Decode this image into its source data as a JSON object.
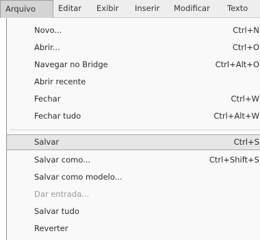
{
  "menubar": {
    "items": [
      {
        "label": "Arquivo"
      },
      {
        "label": "Editar"
      },
      {
        "label": "Exibir"
      },
      {
        "label": "Inserir"
      },
      {
        "label": "Modificar"
      },
      {
        "label": "Texto"
      }
    ],
    "active_index": 0
  },
  "menu": {
    "items": [
      {
        "label": "Novo...",
        "shortcut": "Ctrl+N"
      },
      {
        "label": "Abrir...",
        "shortcut": "Ctrl+O"
      },
      {
        "label": "Navegar no Bridge",
        "shortcut": "Ctrl+Alt+O"
      },
      {
        "label": "Abrir recente",
        "shortcut": ""
      },
      {
        "label": "Fechar",
        "shortcut": "Ctrl+W"
      },
      {
        "label": "Fechar tudo",
        "shortcut": "Ctrl+Alt+W"
      },
      {
        "label": "Salvar",
        "shortcut": "Ctrl+S"
      },
      {
        "label": "Salvar como...",
        "shortcut": "Ctrl+Shift+S"
      },
      {
        "label": "Salvar como modelo...",
        "shortcut": ""
      },
      {
        "label": "Dar entrada...",
        "shortcut": "",
        "disabled": true
      },
      {
        "label": "Salvar tudo",
        "shortcut": ""
      },
      {
        "label": "Reverter",
        "shortcut": ""
      }
    ],
    "highlighted_index": 6
  },
  "colors": {
    "menubar_bg": "#eeeeee",
    "menu_bg": "#f9f9f9",
    "highlight_bg": "#e6e6e6",
    "disabled_text": "#9a9a9a"
  }
}
